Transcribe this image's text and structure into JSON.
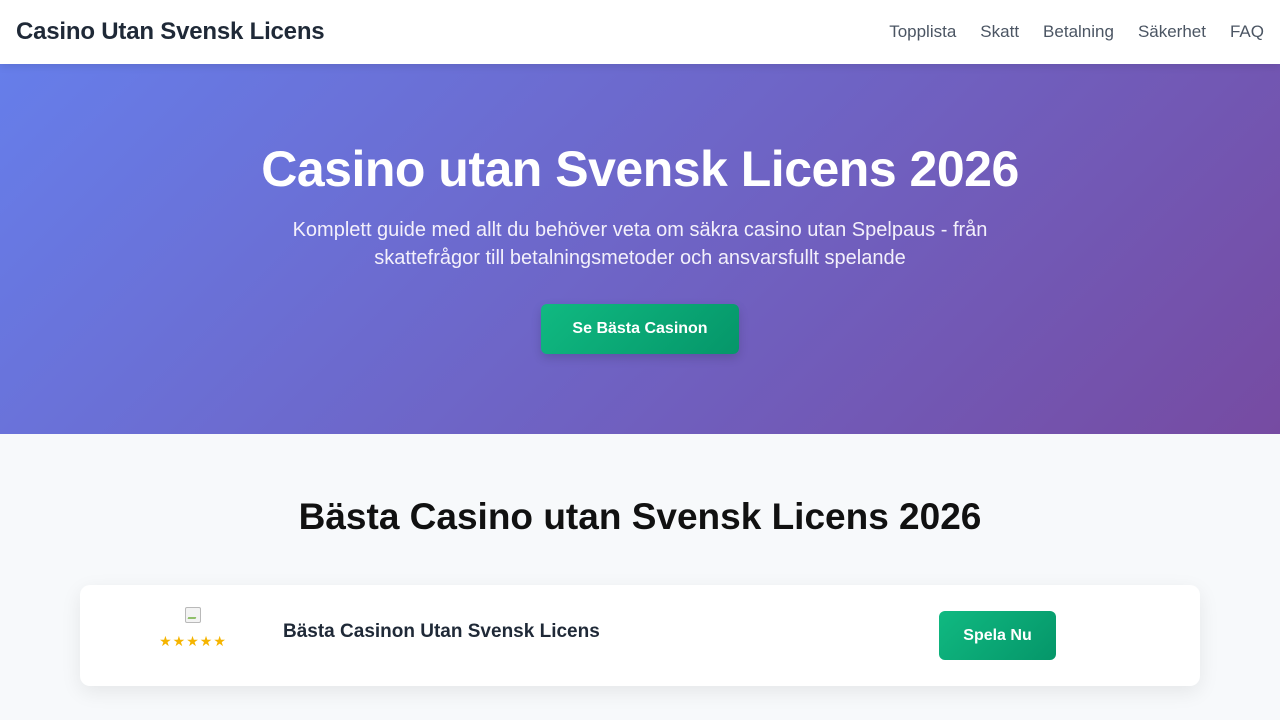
{
  "header": {
    "brand": "Casino Utan Svensk Licens",
    "nav": [
      "Topplista",
      "Skatt",
      "Betalning",
      "Säkerhet",
      "FAQ"
    ]
  },
  "hero": {
    "title": "Casino utan Svensk Licens 2026",
    "subtitle": "Komplett guide med allt du behöver veta om säkra casino utan Spelpaus - från skattefrågor till betalningsmetoder och ansvarsfullt spelande",
    "cta_label": "Se Bästa Casinon"
  },
  "toplist": {
    "title": "Bästa Casino utan Svensk Licens 2026",
    "cards": [
      {
        "name": "Bästa Casinon Utan Svensk Licens",
        "stars": "★★★★★",
        "rating": 5,
        "cta_label": "Spela Nu"
      }
    ]
  },
  "colors": {
    "hero_gradient_start": "#667eea",
    "hero_gradient_end": "#764ba2",
    "cta_green": "#10b981",
    "star_color": "#f5b400"
  }
}
